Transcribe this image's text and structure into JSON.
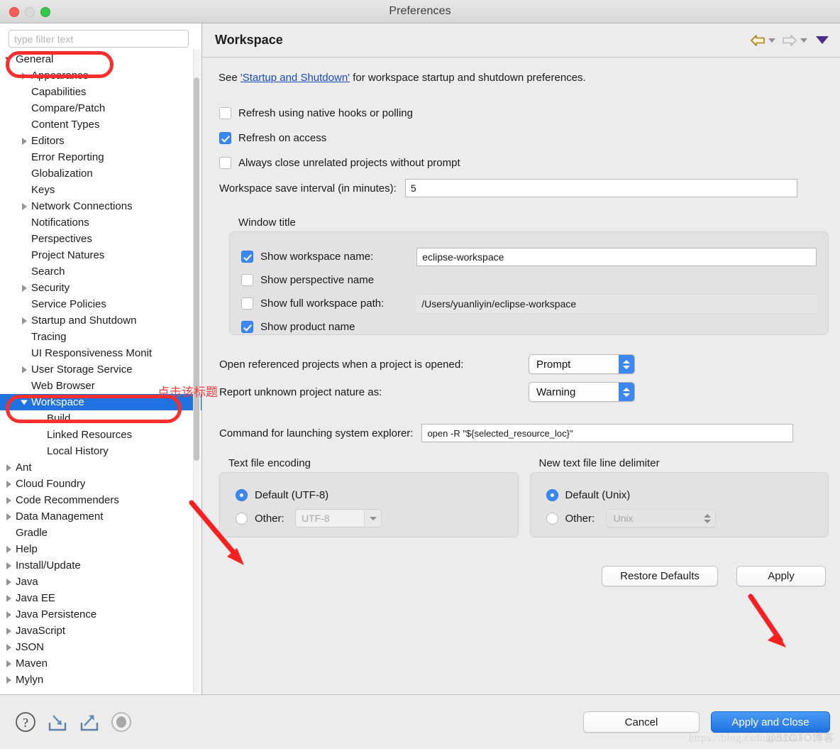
{
  "window": {
    "title": "Preferences",
    "traffic_lights": [
      "close-red",
      "minimize-disabled",
      "zoom-green"
    ]
  },
  "sidebar": {
    "filter_placeholder": "type filter text",
    "filter_value": "",
    "items": [
      {
        "label": "General",
        "indent": 0,
        "arrow": "down",
        "selected": false
      },
      {
        "label": "Appearance",
        "indent": 1,
        "arrow": "right",
        "selected": false
      },
      {
        "label": "Capabilities",
        "indent": 1,
        "arrow": "none",
        "selected": false
      },
      {
        "label": "Compare/Patch",
        "indent": 1,
        "arrow": "none",
        "selected": false
      },
      {
        "label": "Content Types",
        "indent": 1,
        "arrow": "none",
        "selected": false
      },
      {
        "label": "Editors",
        "indent": 1,
        "arrow": "right",
        "selected": false
      },
      {
        "label": "Error Reporting",
        "indent": 1,
        "arrow": "none",
        "selected": false
      },
      {
        "label": "Globalization",
        "indent": 1,
        "arrow": "none",
        "selected": false
      },
      {
        "label": "Keys",
        "indent": 1,
        "arrow": "none",
        "selected": false
      },
      {
        "label": "Network Connections",
        "indent": 1,
        "arrow": "right",
        "selected": false
      },
      {
        "label": "Notifications",
        "indent": 1,
        "arrow": "none",
        "selected": false
      },
      {
        "label": "Perspectives",
        "indent": 1,
        "arrow": "none",
        "selected": false
      },
      {
        "label": "Project Natures",
        "indent": 1,
        "arrow": "none",
        "selected": false
      },
      {
        "label": "Search",
        "indent": 1,
        "arrow": "none",
        "selected": false
      },
      {
        "label": "Security",
        "indent": 1,
        "arrow": "right",
        "selected": false
      },
      {
        "label": "Service Policies",
        "indent": 1,
        "arrow": "none",
        "selected": false
      },
      {
        "label": "Startup and Shutdown",
        "indent": 1,
        "arrow": "right",
        "selected": false
      },
      {
        "label": "Tracing",
        "indent": 1,
        "arrow": "none",
        "selected": false
      },
      {
        "label": "UI Responsiveness Monit",
        "indent": 1,
        "arrow": "none",
        "selected": false
      },
      {
        "label": "User Storage Service",
        "indent": 1,
        "arrow": "right",
        "selected": false
      },
      {
        "label": "Web Browser",
        "indent": 1,
        "arrow": "none",
        "selected": false
      },
      {
        "label": "Workspace",
        "indent": 1,
        "arrow": "down",
        "selected": true
      },
      {
        "label": "Build",
        "indent": 2,
        "arrow": "none",
        "selected": false
      },
      {
        "label": "Linked Resources",
        "indent": 2,
        "arrow": "none",
        "selected": false
      },
      {
        "label": "Local History",
        "indent": 2,
        "arrow": "none",
        "selected": false
      },
      {
        "label": "Ant",
        "indent": 0,
        "arrow": "right",
        "selected": false
      },
      {
        "label": "Cloud Foundry",
        "indent": 0,
        "arrow": "right",
        "selected": false
      },
      {
        "label": "Code Recommenders",
        "indent": 0,
        "arrow": "right",
        "selected": false
      },
      {
        "label": "Data Management",
        "indent": 0,
        "arrow": "right",
        "selected": false
      },
      {
        "label": "Gradle",
        "indent": 0,
        "arrow": "none",
        "selected": false
      },
      {
        "label": "Help",
        "indent": 0,
        "arrow": "right",
        "selected": false
      },
      {
        "label": "Install/Update",
        "indent": 0,
        "arrow": "right",
        "selected": false
      },
      {
        "label": "Java",
        "indent": 0,
        "arrow": "right",
        "selected": false
      },
      {
        "label": "Java EE",
        "indent": 0,
        "arrow": "right",
        "selected": false
      },
      {
        "label": "Java Persistence",
        "indent": 0,
        "arrow": "right",
        "selected": false
      },
      {
        "label": "JavaScript",
        "indent": 0,
        "arrow": "right",
        "selected": false
      },
      {
        "label": "JSON",
        "indent": 0,
        "arrow": "right",
        "selected": false
      },
      {
        "label": "Maven",
        "indent": 0,
        "arrow": "right",
        "selected": false
      },
      {
        "label": "Mylyn",
        "indent": 0,
        "arrow": "right",
        "selected": false
      }
    ]
  },
  "panel": {
    "title": "Workspace",
    "nav": {
      "back_icon": "back-arrow-icon",
      "forward_icon": "forward-arrow-icon",
      "menu_icon": "dropdown-triangle-icon"
    },
    "intro": {
      "prefix": "See ",
      "link": "'Startup and Shutdown'",
      "suffix": " for workspace startup and shutdown preferences."
    },
    "checkboxes": [
      {
        "label": "Refresh using native hooks or polling",
        "checked": false
      },
      {
        "label": "Refresh on access",
        "checked": true
      },
      {
        "label": "Always close unrelated projects without prompt",
        "checked": false
      }
    ],
    "save_interval": {
      "label": "Workspace save interval (in minutes):",
      "value": "5"
    },
    "window_title_group": {
      "title": "Window title",
      "show_workspace_name": {
        "label": "Show workspace name:",
        "checked": true,
        "value": "eclipse-workspace"
      },
      "show_perspective_name": {
        "label": "Show perspective name",
        "checked": false
      },
      "show_full_workspace_path": {
        "label": "Show full workspace path:",
        "checked": false,
        "value": "/Users/yuanliyin/eclipse-workspace"
      },
      "show_product_name": {
        "label": "Show product name",
        "checked": true
      }
    },
    "open_referenced": {
      "label": "Open referenced projects when a project is opened:",
      "value": "Prompt"
    },
    "report_nature": {
      "label": "Report unknown project nature as:",
      "value": "Warning"
    },
    "explorer_command": {
      "label": "Command for launching system explorer:",
      "value": "open -R \"${selected_resource_loc}\""
    },
    "text_file_encoding": {
      "title": "Text file encoding",
      "default_label": "Default (UTF-8)",
      "default_selected": true,
      "other_label": "Other:",
      "other_selected": false,
      "other_value": "UTF-8"
    },
    "line_delimiter": {
      "title": "New text file line delimiter",
      "default_label": "Default (Unix)",
      "default_selected": true,
      "other_label": "Other:",
      "other_selected": false,
      "other_value": "Unix"
    },
    "restore_defaults_label": "Restore Defaults",
    "apply_label": "Apply"
  },
  "footer": {
    "icons": [
      "help-question-icon",
      "import-icon",
      "export-icon",
      "record-disabled-icon"
    ],
    "cancel_label": "Cancel",
    "apply_and_close_label": "Apply and Close"
  },
  "annotations": {
    "click_title_text": "点击该标题"
  },
  "watermark": {
    "url": "https://blog.csdn.net/Yua",
    "site": "@51CTO博客"
  },
  "colors": {
    "selection_blue": "#1f72e0",
    "annotation_red": "#fb2e2e",
    "link_blue": "#1a4bbd",
    "control_blue": "#3b88f5"
  }
}
